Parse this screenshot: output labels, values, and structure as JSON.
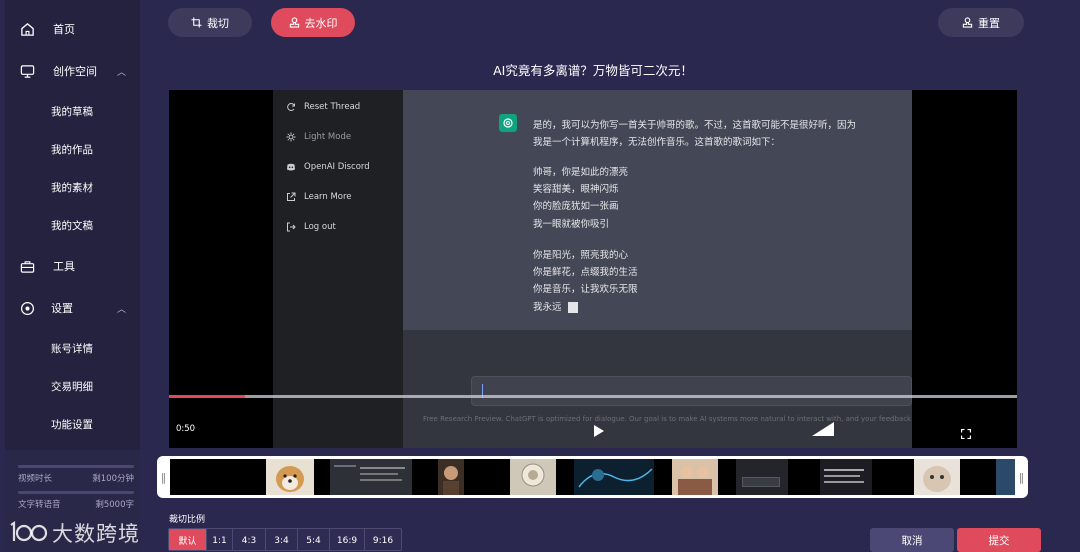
{
  "sidebar": {
    "items": [
      {
        "label": "首页",
        "icon": "home-icon"
      },
      {
        "label": "创作空间",
        "icon": "monitor-icon",
        "expanded": true,
        "children": [
          "我的草稿",
          "我的作品",
          "我的素材",
          "我的文稿"
        ]
      },
      {
        "label": "工具",
        "icon": "toolbox-icon"
      },
      {
        "label": "设置",
        "icon": "settings-icon",
        "expanded": true,
        "children": [
          "账号详情",
          "交易明细",
          "功能设置"
        ]
      }
    ],
    "usage": {
      "video_label": "视频时长",
      "video_value": "剩100分钟",
      "tts_label": "文字转语音",
      "tts_value": "剩5000字"
    }
  },
  "watermark": {
    "text": "大数跨境"
  },
  "toolbar": {
    "crop_label": "裁切",
    "remove_watermark_label": "去水印",
    "reset_label": "重置"
  },
  "video": {
    "title": "AI究竟有多离谱？万物皆可二次元！",
    "menu": [
      "Reset Thread",
      "Light Mode",
      "OpenAI Discord",
      "Learn More",
      "Log out"
    ],
    "chat_lines": [
      "是的，我可以为你写一首关于帅哥的歌。不过，这首歌可能不是很好听，因为",
      "我是一个计算机程序，无法创作音乐。这首歌的歌词如下：",
      "帅哥，你是如此的漂亮",
      "笑容甜美，眼神闪烁",
      "你的脸庞犹如一张画",
      "我一眼就被你吸引",
      "你是阳光，照亮我的心",
      "你是鲜花，点缀我的生活",
      "你是音乐，让我欢乐无限",
      "我永远"
    ],
    "footnote": "Free Research Preview. ChatGPT is optimized for dialogue. Our goal is to make AI systems more natural to interact with, and your feedback",
    "current_time": "0:50",
    "progress": 0.09,
    "close_glyph": "✕"
  },
  "ratio": {
    "label": "裁切比例",
    "options": [
      "默认",
      "1:1",
      "4:3",
      "3:4",
      "5:4",
      "16:9",
      "9:16"
    ],
    "active_index": 0
  },
  "actions": {
    "cancel_label": "取消",
    "submit_label": "提交"
  },
  "colors": {
    "accent": "#e04a5d",
    "background": "#2b2850",
    "sidebar": "#24223f",
    "crop_handle": "#66dd66"
  }
}
